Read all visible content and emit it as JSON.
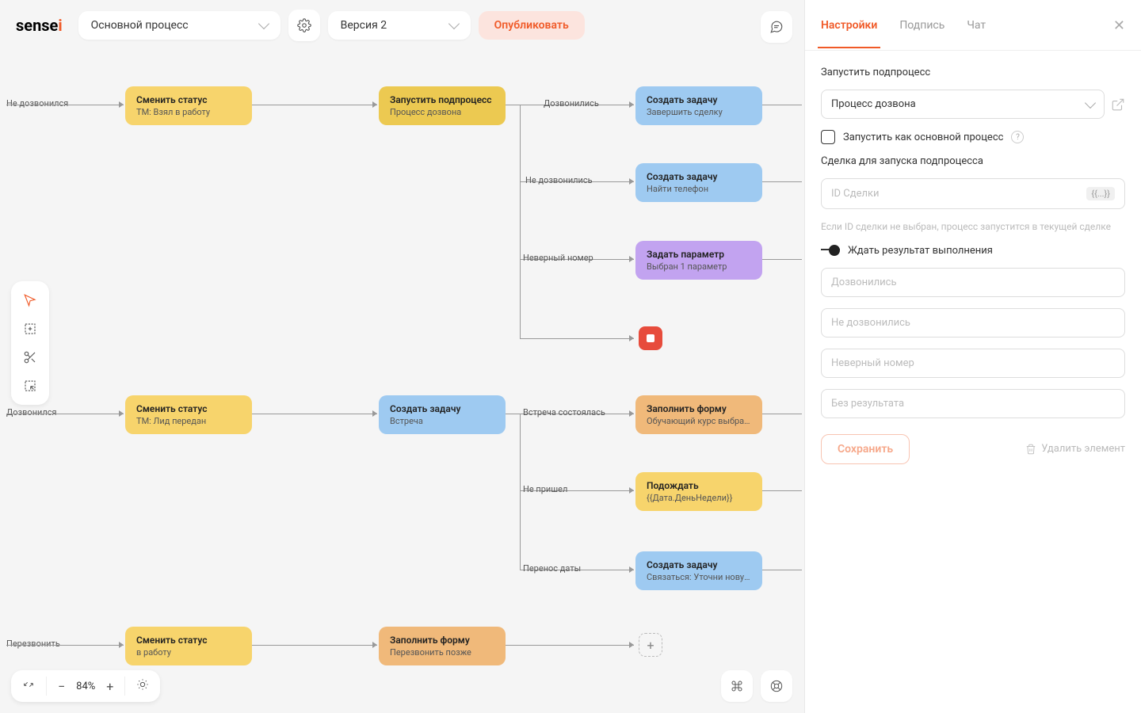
{
  "header": {
    "logo_main": "sense",
    "logo_accent": "i",
    "process_dropdown": "Основной процесс",
    "version_dropdown": "Версия 2",
    "publish": "Опубликовать"
  },
  "labels": {
    "nedozvon": "Не дозвонился",
    "dozvon_top": "Дозвонились",
    "nedozvon2": "Не дозвонились",
    "wrongnum": "Неверный номер",
    "dozvon_left": "Дозвонился",
    "meeting_done": "Встреча состоялась",
    "noshow": "Не пришел",
    "reschedule": "Перенос даты",
    "callback": "Перезвонить"
  },
  "nodes": {
    "n1": {
      "title": "Сменить статус",
      "sub": "ТМ: Взял в работу"
    },
    "n2": {
      "title": "Запустить подпроцесс",
      "sub": "Процесс дозвона"
    },
    "n3": {
      "title": "Создать задачу",
      "sub": "Завершить сделку"
    },
    "n4": {
      "title": "Создать задачу",
      "sub": "Найти телефон"
    },
    "n5": {
      "title": "Задать параметр",
      "sub": "Выбран 1 параметр"
    },
    "n6": {
      "title": "Сменить статус",
      "sub": "ТМ: Лид передан"
    },
    "n7": {
      "title": "Создать задачу",
      "sub": "Встреча"
    },
    "n8": {
      "title": "Заполнить форму",
      "sub": "Обучающий курс выбран..."
    },
    "n9": {
      "title": "Подождать",
      "sub": "{{Дата.ДеньНедели}}"
    },
    "n10": {
      "title": "Создать задачу",
      "sub": "Связаться: Уточни новую..."
    },
    "n11": {
      "title": "Сменить статус",
      "sub": "    в работу"
    },
    "n12": {
      "title": "Заполнить форму",
      "sub": "Перезвонить позже"
    }
  },
  "bottombar": {
    "zoom": "84%"
  },
  "panel": {
    "tabs": {
      "settings": "Настройки",
      "signature": "Подпись",
      "chat": "Чат"
    },
    "section_label": "Запустить подпроцесс",
    "select_value": "Процесс дозвона",
    "checkbox_label": "Запустить как основной процесс",
    "deal_label": "Сделка для запуска подпроцесса",
    "deal_placeholder": "ID Сделки",
    "deal_hint": "Если ID сделки не выбран, процесс запустится в текущей сделке",
    "wait_label": "Ждать результат выполнения",
    "results": [
      "Дозвонились",
      "Не дозвонились",
      "Неверный номер",
      "Без результата"
    ],
    "save": "Сохранить",
    "delete": "Удалить элемент",
    "brace": "{{...}}"
  }
}
